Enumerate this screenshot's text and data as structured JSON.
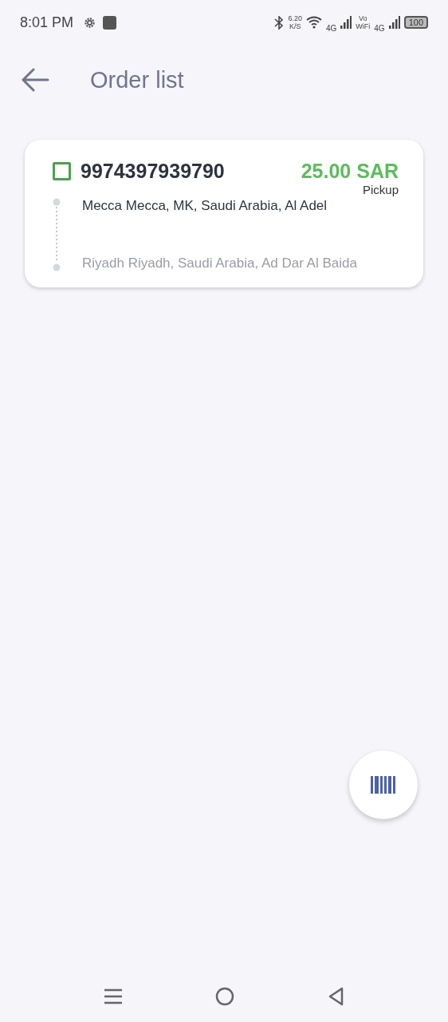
{
  "status_bar": {
    "time": "8:01 PM",
    "speed": "6.20",
    "speed_unit": "K/S",
    "network_1": "4G",
    "volte_top": "Vo",
    "volte_bottom": "WiFi",
    "network_2": "4G",
    "battery": "100"
  },
  "header": {
    "title": "Order list"
  },
  "orders": [
    {
      "number": "9974397939790",
      "checked": false,
      "price": "25.00 SAR",
      "type": "Pickup",
      "from": "Mecca Mecca, MK, Saudi Arabia, Al Adel",
      "to": "Riyadh Riyadh, Saudi Arabia, Ad Dar Al Baida"
    }
  ]
}
